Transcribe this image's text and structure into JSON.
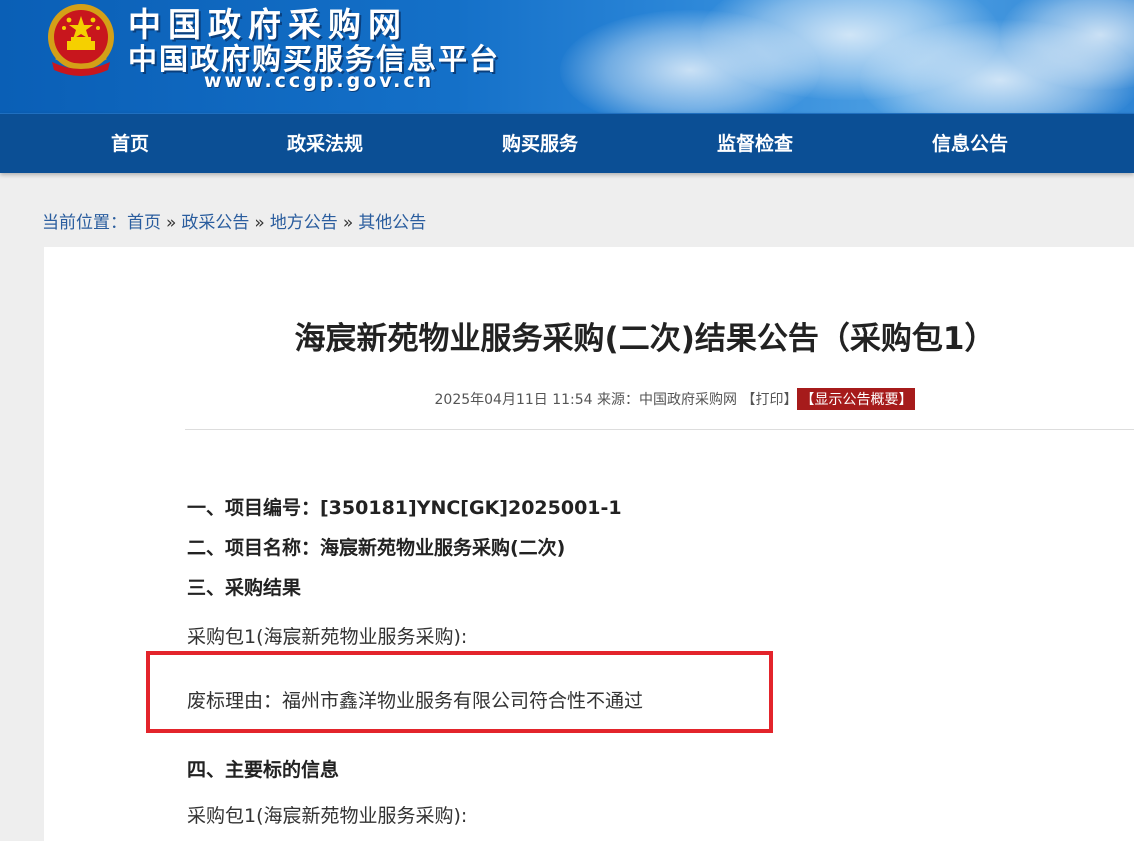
{
  "header": {
    "site_name": "中国政府采购网",
    "site_subtitle": "中国政府购买服务信息平台",
    "site_url": "www.ccgp.gov.cn",
    "emblem_icon": "national-emblem-icon",
    "colors": {
      "banner": "#1470c8",
      "nav": "#0b4f95",
      "accent_red": "#a61b1b",
      "highlight_box": "#e3242b"
    }
  },
  "nav": {
    "items": [
      {
        "label": "首页"
      },
      {
        "label": "政采法规"
      },
      {
        "label": "购买服务"
      },
      {
        "label": "监督检查"
      },
      {
        "label": "信息公告"
      }
    ]
  },
  "breadcrumb": {
    "prefix": "当前位置：",
    "links": [
      "首页",
      "政采公告",
      "地方公告",
      "其他公告"
    ],
    "separator": "»"
  },
  "article": {
    "title": "海宸新苑物业服务采购(二次)结果公告（采购包1）",
    "meta": {
      "date": "2025年04月11日 11:54",
      "source_label": "来源：",
      "source": "中国政府采购网",
      "print_label": "【打印】",
      "summary_label": "【显示公告概要】"
    },
    "sections": {
      "project_number": "一、项目编号：[350181]YNC[GK]2025001-1",
      "project_name": "二、项目名称：海宸新苑物业服务采购(二次)",
      "result_heading": "三、采购结果",
      "package_line": "采购包1(海宸新苑物业服务采购):",
      "abandon_reason": "废标理由：福州市鑫洋物业服务有限公司符合性不通过",
      "main_info_heading": "四、主要标的信息",
      "package_line_2": "采购包1(海宸新苑物业服务采购):"
    }
  }
}
